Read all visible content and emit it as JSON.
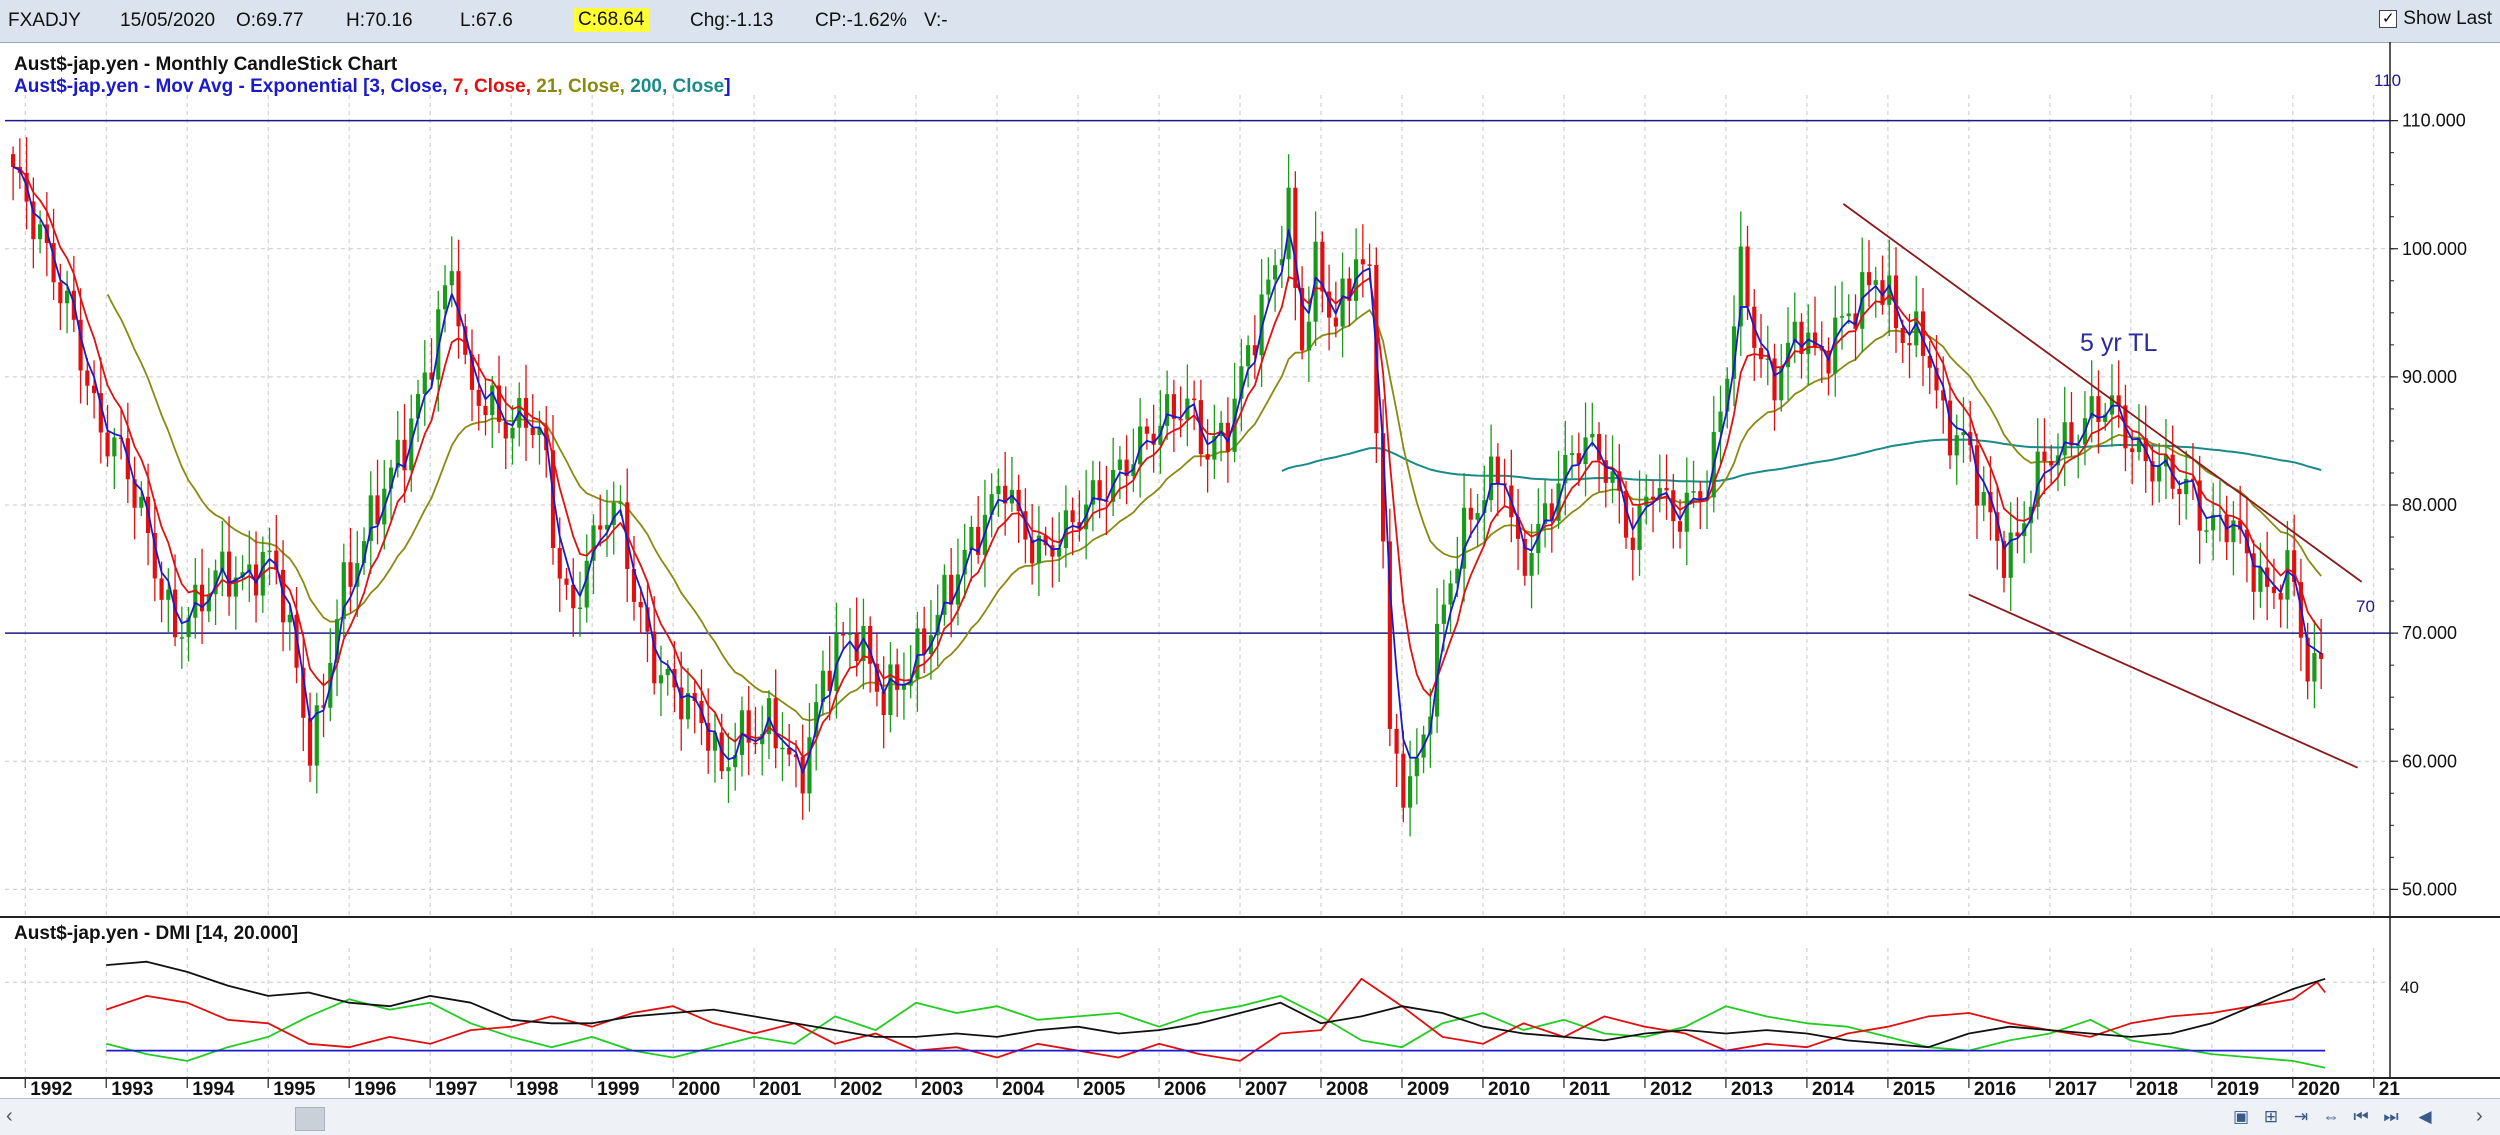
{
  "topbar": {
    "symbol": "FXADJY",
    "date": "15/05/2020",
    "open": "O:69.77",
    "high": "H:70.16",
    "low": "L:67.6",
    "close": "C:68.64",
    "change": "Chg:-1.13",
    "change_pct": "CP:-1.62%",
    "volume": "V:-",
    "show_last_label": "Show Last",
    "show_last_checked": true
  },
  "price_panel": {
    "title": "Aust$-jap.yen - Monthly CandleStick Chart",
    "ma_prefix": "Aust$-jap.yen - Mov Avg - Exponential [",
    "ma_params": [
      {
        "text": "3, Close, ",
        "color": "#1a1acc"
      },
      {
        "text": "7, Close, ",
        "color": "#e01010"
      },
      {
        "text": "21, Close, ",
        "color": "#8a8a10"
      },
      {
        "text": "200, Close",
        "color": "#1a8a8a"
      }
    ],
    "ma_suffix": "]",
    "hline_labels": [
      "110",
      "70"
    ],
    "trendline_label": "5 yr TL"
  },
  "indicator_panel": {
    "title": "Aust$-jap.yen - DMI [14, 20.000]",
    "axis_label": "40"
  },
  "colors": {
    "up_candle": "#1a9a1a",
    "down_candle": "#e01010",
    "ema3": "#1a1acc",
    "ema7": "#e01010",
    "ema21": "#8a8a10",
    "ema200": "#1a8a8a",
    "hline": "#1a1a8a",
    "trendline": "#8a1a1a",
    "adx": "#111111",
    "plus_di": "#22cc22",
    "minus_di": "#e01010",
    "threshold": "#1a1acc",
    "grid": "#c8c8c8"
  },
  "chart_data": {
    "type": "candlestick",
    "frequency": "monthly",
    "x_tick_labels": [
      "1992",
      "1993",
      "1994",
      "1995",
      "1996",
      "1997",
      "1998",
      "1999",
      "2000",
      "2001",
      "2002",
      "2003",
      "2004",
      "2005",
      "2006",
      "2007",
      "2008",
      "2009",
      "2010",
      "2011",
      "2012",
      "2013",
      "2014",
      "2015",
      "2016",
      "2017",
      "2018",
      "2019",
      "2020",
      "21"
    ],
    "y_tick_labels": [
      "110.000",
      "100.000",
      "90.000",
      "80.000",
      "70.000",
      "60.000",
      "50.000"
    ],
    "ylim": [
      48,
      112
    ],
    "xlim": [
      1991.75,
      2021.2
    ],
    "grid": true,
    "price_path": [
      [
        1991.85,
        106
      ],
      [
        1992.0,
        104
      ],
      [
        1992.3,
        99
      ],
      [
        1992.6,
        94
      ],
      [
        1992.9,
        86
      ],
      [
        1993.2,
        84
      ],
      [
        1993.45,
        79
      ],
      [
        1993.65,
        74
      ],
      [
        1993.85,
        70
      ],
      [
        1994.1,
        72
      ],
      [
        1994.4,
        75
      ],
      [
        1994.7,
        74
      ],
      [
        1995.0,
        76
      ],
      [
        1995.15,
        74
      ],
      [
        1995.35,
        67
      ],
      [
        1995.5,
        61
      ],
      [
        1995.65,
        63
      ],
      [
        1995.85,
        72
      ],
      [
        1996.1,
        76
      ],
      [
        1996.4,
        81
      ],
      [
        1996.7,
        85
      ],
      [
        1996.95,
        90
      ],
      [
        1997.2,
        97
      ],
      [
        1997.3,
        99
      ],
      [
        1997.45,
        89
      ],
      [
        1997.7,
        88
      ],
      [
        1997.95,
        86
      ],
      [
        1998.2,
        87
      ],
      [
        1998.4,
        85
      ],
      [
        1998.55,
        76
      ],
      [
        1998.75,
        71
      ],
      [
        1998.95,
        76
      ],
      [
        1999.2,
        80
      ],
      [
        1999.35,
        79
      ],
      [
        1999.55,
        72
      ],
      [
        1999.8,
        67
      ],
      [
        2000.1,
        65
      ],
      [
        2000.4,
        63
      ],
      [
        2000.6,
        59
      ],
      [
        2000.8,
        62
      ],
      [
        2001.0,
        62
      ],
      [
        2001.2,
        63
      ],
      [
        2001.4,
        61
      ],
      [
        2001.55,
        58
      ],
      [
        2001.8,
        65
      ],
      [
        2002.0,
        69
      ],
      [
        2002.3,
        70
      ],
      [
        2002.55,
        65
      ],
      [
        2002.8,
        66
      ],
      [
        2003.0,
        68
      ],
      [
        2003.3,
        72
      ],
      [
        2003.6,
        76
      ],
      [
        2003.85,
        79
      ],
      [
        2004.1,
        82
      ],
      [
        2004.3,
        78
      ],
      [
        2004.55,
        76
      ],
      [
        2004.85,
        78
      ],
      [
        2005.1,
        80
      ],
      [
        2005.45,
        82
      ],
      [
        2005.8,
        85
      ],
      [
        2006.1,
        87
      ],
      [
        2006.35,
        88
      ],
      [
        2006.6,
        84
      ],
      [
        2006.85,
        86
      ],
      [
        2007.1,
        92
      ],
      [
        2007.4,
        98
      ],
      [
        2007.6,
        103
      ],
      [
        2007.75,
        92
      ],
      [
        2007.95,
        99
      ],
      [
        2008.15,
        94
      ],
      [
        2008.3,
        96
      ],
      [
        2008.45,
        100
      ],
      [
        2008.6,
        97
      ],
      [
        2008.75,
        80
      ],
      [
        2008.85,
        62
      ],
      [
        2008.95,
        59
      ],
      [
        2009.1,
        58
      ],
      [
        2009.25,
        61
      ],
      [
        2009.45,
        70
      ],
      [
        2009.7,
        77
      ],
      [
        2010.0,
        81
      ],
      [
        2010.25,
        83
      ],
      [
        2010.45,
        75
      ],
      [
        2010.7,
        78
      ],
      [
        2010.95,
        82
      ],
      [
        2011.2,
        85
      ],
      [
        2011.45,
        84
      ],
      [
        2011.7,
        80
      ],
      [
        2011.85,
        77
      ],
      [
        2012.1,
        82
      ],
      [
        2012.35,
        79
      ],
      [
        2012.55,
        80
      ],
      [
        2012.8,
        82
      ],
      [
        2013.0,
        90
      ],
      [
        2013.2,
        99
      ],
      [
        2013.35,
        93
      ],
      [
        2013.55,
        89
      ],
      [
        2013.75,
        92
      ],
      [
        2013.95,
        94
      ],
      [
        2014.15,
        91
      ],
      [
        2014.4,
        94
      ],
      [
        2014.65,
        96
      ],
      [
        2014.85,
        98
      ],
      [
        2015.0,
        96
      ],
      [
        2015.2,
        93
      ],
      [
        2015.45,
        93
      ],
      [
        2015.7,
        86
      ],
      [
        2015.95,
        85
      ],
      [
        2016.2,
        80
      ],
      [
        2016.4,
        76
      ],
      [
        2016.6,
        77
      ],
      [
        2016.8,
        82
      ],
      [
        2017.0,
        84
      ],
      [
        2017.25,
        85
      ],
      [
        2017.5,
        87
      ],
      [
        2017.7,
        88
      ],
      [
        2017.85,
        87
      ],
      [
        2018.05,
        84
      ],
      [
        2018.3,
        83
      ],
      [
        2018.55,
        82
      ],
      [
        2018.75,
        81
      ],
      [
        2018.95,
        78
      ],
      [
        2019.2,
        79
      ],
      [
        2019.45,
        76
      ],
      [
        2019.65,
        73
      ],
      [
        2019.85,
        74
      ],
      [
        2020.0,
        75
      ],
      [
        2020.15,
        68
      ],
      [
        2020.25,
        65
      ],
      [
        2020.3,
        69
      ],
      [
        2020.4,
        69
      ]
    ],
    "reference_lines": [
      110,
      70
    ],
    "trendline_upper": [
      [
        2014.45,
        103.5
      ],
      [
        2020.85,
        74.0
      ]
    ],
    "trendline_lower": [
      [
        2016.0,
        73.0
      ],
      [
        2020.8,
        59.5
      ]
    ],
    "ema200_start": 2007.5,
    "indicator": {
      "name": "DMI",
      "period": 14,
      "threshold": 20,
      "ylim": [
        12,
        50
      ],
      "y_tick": 40,
      "adx": [
        [
          1993.0,
          45
        ],
        [
          1993.5,
          46
        ],
        [
          1994.0,
          43
        ],
        [
          1994.5,
          39
        ],
        [
          1995.0,
          36
        ],
        [
          1995.5,
          37
        ],
        [
          1996.0,
          34
        ],
        [
          1996.5,
          33
        ],
        [
          1997.0,
          36
        ],
        [
          1997.5,
          34
        ],
        [
          1998.0,
          29
        ],
        [
          1998.5,
          28
        ],
        [
          1999.0,
          28
        ],
        [
          1999.5,
          30
        ],
        [
          2000.0,
          31
        ],
        [
          2000.5,
          32
        ],
        [
          2001.0,
          30
        ],
        [
          2001.5,
          28
        ],
        [
          2002.0,
          26
        ],
        [
          2002.5,
          24
        ],
        [
          2003.0,
          24
        ],
        [
          2003.5,
          25
        ],
        [
          2004.0,
          24
        ],
        [
          2004.5,
          26
        ],
        [
          2005.0,
          27
        ],
        [
          2005.5,
          25
        ],
        [
          2006.0,
          26
        ],
        [
          2006.5,
          28
        ],
        [
          2007.0,
          31
        ],
        [
          2007.5,
          34
        ],
        [
          2008.0,
          28
        ],
        [
          2008.5,
          30
        ],
        [
          2009.0,
          33
        ],
        [
          2009.5,
          31
        ],
        [
          2010.0,
          27
        ],
        [
          2010.5,
          25
        ],
        [
          2011.0,
          24
        ],
        [
          2011.5,
          23
        ],
        [
          2012.0,
          25
        ],
        [
          2012.5,
          26
        ],
        [
          2013.0,
          25
        ],
        [
          2013.5,
          26
        ],
        [
          2014.0,
          25
        ],
        [
          2014.5,
          23
        ],
        [
          2015.0,
          22
        ],
        [
          2015.5,
          21
        ],
        [
          2016.0,
          25
        ],
        [
          2016.5,
          27
        ],
        [
          2017.0,
          26
        ],
        [
          2017.5,
          25
        ],
        [
          2018.0,
          24
        ],
        [
          2018.5,
          25
        ],
        [
          2019.0,
          28
        ],
        [
          2019.5,
          33
        ],
        [
          2020.0,
          38
        ],
        [
          2020.4,
          41
        ]
      ],
      "plus_di": [
        [
          1993.0,
          22
        ],
        [
          1993.5,
          19
        ],
        [
          1994.0,
          17
        ],
        [
          1994.5,
          21
        ],
        [
          1995.0,
          24
        ],
        [
          1995.5,
          30
        ],
        [
          1996.0,
          35
        ],
        [
          1996.5,
          32
        ],
        [
          1997.0,
          34
        ],
        [
          1997.5,
          28
        ],
        [
          1998.0,
          24
        ],
        [
          1998.5,
          21
        ],
        [
          1999.0,
          24
        ],
        [
          1999.5,
          20
        ],
        [
          2000.0,
          18
        ],
        [
          2000.5,
          21
        ],
        [
          2001.0,
          24
        ],
        [
          2001.5,
          22
        ],
        [
          2002.0,
          30
        ],
        [
          2002.5,
          26
        ],
        [
          2003.0,
          34
        ],
        [
          2003.5,
          31
        ],
        [
          2004.0,
          33
        ],
        [
          2004.5,
          29
        ],
        [
          2005.0,
          30
        ],
        [
          2005.5,
          31
        ],
        [
          2006.0,
          27
        ],
        [
          2006.5,
          31
        ],
        [
          2007.0,
          33
        ],
        [
          2007.5,
          36
        ],
        [
          2008.0,
          30
        ],
        [
          2008.5,
          23
        ],
        [
          2009.0,
          21
        ],
        [
          2009.5,
          28
        ],
        [
          2010.0,
          31
        ],
        [
          2010.5,
          26
        ],
        [
          2011.0,
          29
        ],
        [
          2011.5,
          25
        ],
        [
          2012.0,
          24
        ],
        [
          2012.5,
          27
        ],
        [
          2013.0,
          33
        ],
        [
          2013.5,
          30
        ],
        [
          2014.0,
          28
        ],
        [
          2014.5,
          27
        ],
        [
          2015.0,
          24
        ],
        [
          2015.5,
          21
        ],
        [
          2016.0,
          20
        ],
        [
          2016.5,
          23
        ],
        [
          2017.0,
          25
        ],
        [
          2017.5,
          29
        ],
        [
          2018.0,
          23
        ],
        [
          2018.5,
          21
        ],
        [
          2019.0,
          19
        ],
        [
          2019.5,
          18
        ],
        [
          2020.0,
          17
        ],
        [
          2020.4,
          15
        ]
      ],
      "minus_di": [
        [
          1993.0,
          32
        ],
        [
          1993.5,
          36
        ],
        [
          1994.0,
          34
        ],
        [
          1994.5,
          29
        ],
        [
          1995.0,
          28
        ],
        [
          1995.5,
          22
        ],
        [
          1996.0,
          21
        ],
        [
          1996.5,
          24
        ],
        [
          1997.0,
          22
        ],
        [
          1997.5,
          26
        ],
        [
          1998.0,
          27
        ],
        [
          1998.5,
          30
        ],
        [
          1999.0,
          27
        ],
        [
          1999.5,
          31
        ],
        [
          2000.0,
          33
        ],
        [
          2000.5,
          28
        ],
        [
          2001.0,
          25
        ],
        [
          2001.5,
          28
        ],
        [
          2002.0,
          22
        ],
        [
          2002.5,
          25
        ],
        [
          2003.0,
          20
        ],
        [
          2003.5,
          21
        ],
        [
          2004.0,
          18
        ],
        [
          2004.5,
          22
        ],
        [
          2005.0,
          20
        ],
        [
          2005.5,
          18
        ],
        [
          2006.0,
          22
        ],
        [
          2006.5,
          19
        ],
        [
          2007.0,
          17
        ],
        [
          2007.5,
          25
        ],
        [
          2008.0,
          26
        ],
        [
          2008.5,
          41
        ],
        [
          2009.0,
          33
        ],
        [
          2009.5,
          24
        ],
        [
          2010.0,
          22
        ],
        [
          2010.5,
          28
        ],
        [
          2011.0,
          24
        ],
        [
          2011.5,
          30
        ],
        [
          2012.0,
          27
        ],
        [
          2012.5,
          25
        ],
        [
          2013.0,
          20
        ],
        [
          2013.5,
          22
        ],
        [
          2014.0,
          21
        ],
        [
          2014.5,
          25
        ],
        [
          2015.0,
          27
        ],
        [
          2015.5,
          30
        ],
        [
          2016.0,
          31
        ],
        [
          2016.5,
          28
        ],
        [
          2017.0,
          26
        ],
        [
          2017.5,
          24
        ],
        [
          2018.0,
          28
        ],
        [
          2018.5,
          30
        ],
        [
          2019.0,
          31
        ],
        [
          2019.5,
          33
        ],
        [
          2020.0,
          35
        ],
        [
          2020.3,
          40
        ],
        [
          2020.4,
          37
        ]
      ]
    }
  }
}
